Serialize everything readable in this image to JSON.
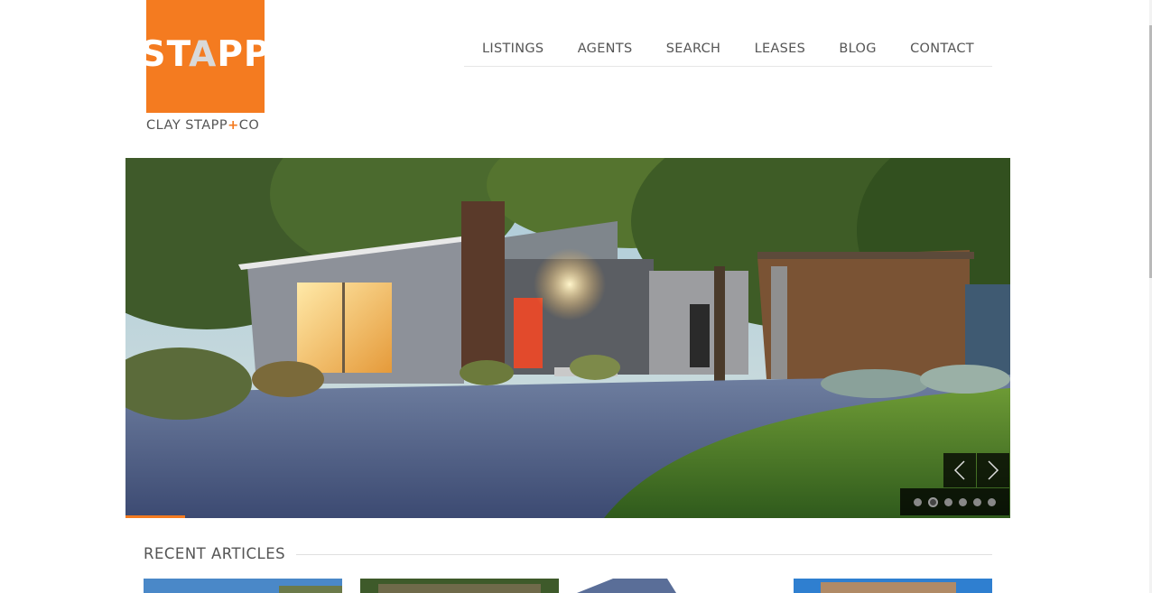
{
  "brand": {
    "logo_word_start": "ST",
    "logo_word_mark": "A",
    "logo_word_end": "PP",
    "name_start": "CLAY STAPP",
    "name_plus": "+",
    "name_end": "CO",
    "accent_color": "#f47b20"
  },
  "nav": {
    "items": [
      {
        "label": "LISTINGS"
      },
      {
        "label": "AGENTS"
      },
      {
        "label": "SEARCH"
      },
      {
        "label": "LEASES"
      },
      {
        "label": "BLOG"
      },
      {
        "label": "CONTACT"
      }
    ]
  },
  "slider": {
    "prev_icon": "chevron-left-icon",
    "next_icon": "chevron-right-icon",
    "slide_count": 6,
    "active_slide": 2
  },
  "recent_articles": {
    "title": "RECENT ARTICLES"
  }
}
